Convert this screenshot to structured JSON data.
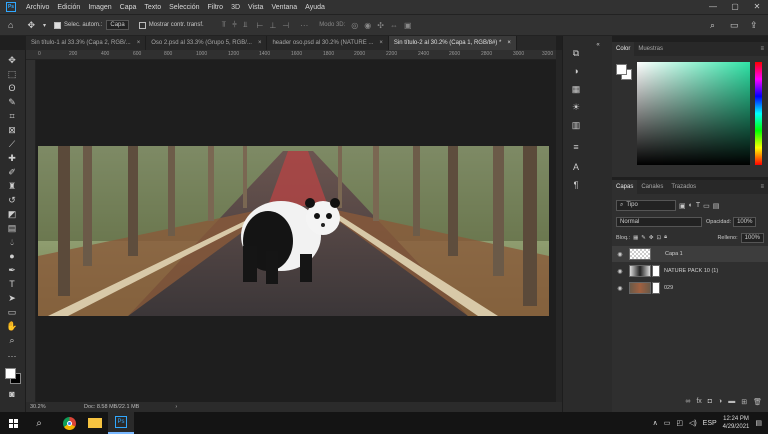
{
  "menubar": {
    "items": [
      "Archivo",
      "Edición",
      "Imagen",
      "Capa",
      "Texto",
      "Selección",
      "Filtro",
      "3D",
      "Vista",
      "Ventana",
      "Ayuda"
    ],
    "logo": "Ps",
    "controls": [
      "—",
      "▢",
      "✕"
    ]
  },
  "options": {
    "auto_select_label": "Selec. autom.:",
    "target": "Capa",
    "show_transform": "Mostrar contr. transf.",
    "mode3d": "Modo 3D:"
  },
  "tabs": [
    {
      "label": "Sin título-1 al 33.3% (Capa 2, RGB/...",
      "close": "×"
    },
    {
      "label": "Oso 2.psd al 33.3% (Grupo 5, RGB/...",
      "close": "×"
    },
    {
      "label": "header oso.psd al 30.2% (NATURE ...",
      "close": "×"
    },
    {
      "label": "Sin título-2 al 30.2% (Capa 1, RGB/8#) *",
      "close": "×"
    }
  ],
  "ruler": [
    "0",
    "200",
    "400",
    "600",
    "800",
    "1000",
    "1200",
    "1400",
    "1600",
    "1800",
    "2000",
    "2200",
    "2400",
    "2600",
    "2800",
    "3000",
    "3200"
  ],
  "status": {
    "zoom": "30.2%",
    "doc": "Doc: 8.58 MB/22.1 MB",
    "arrow": "›"
  },
  "color_panel": {
    "tabs": [
      "Color",
      "Muestras"
    ]
  },
  "layers_panel": {
    "tabs": [
      "Capas",
      "Canales",
      "Trazados"
    ],
    "filter": "Tipo",
    "blend": "Normal",
    "opacity_label": "Opacidad:",
    "opacity": "100%",
    "lock_label": "Bloq.:",
    "fill_label": "Relleno:",
    "fill": "100%",
    "layers": [
      {
        "name": "Capa 1"
      },
      {
        "name": "NATURE PACK 10 (1)"
      },
      {
        "name": "029"
      }
    ]
  },
  "taskbar": {
    "time": "12:24 PM",
    "date": "4/29/2021",
    "lang": "ESP"
  }
}
